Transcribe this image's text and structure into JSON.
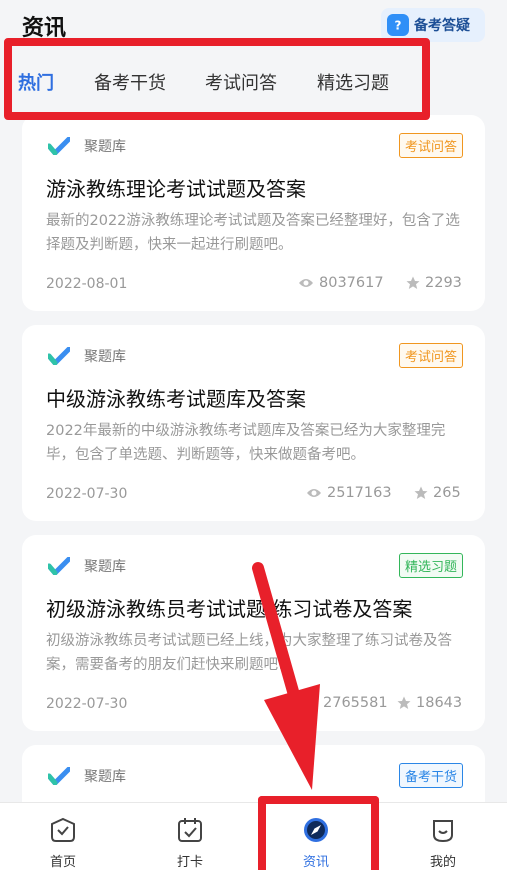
{
  "header": {
    "title": "资讯",
    "qa_label": "备考答疑"
  },
  "tabs": [
    {
      "label": "热门",
      "active": true
    },
    {
      "label": "备考干货",
      "active": false
    },
    {
      "label": "考试问答",
      "active": false
    },
    {
      "label": "精选习题",
      "active": false
    }
  ],
  "articles": [
    {
      "source": "聚题库",
      "tag": "考试问答",
      "tag_color": "#f0961f",
      "title": "游泳教练理论考试试题及答案",
      "desc": "最新的2022游泳教练理论考试试题及答案已经整理好，包含了选择题及判断题，快来一起进行刷题吧。",
      "date": "2022-08-01",
      "views": "8037617",
      "stars": "2293"
    },
    {
      "source": "聚题库",
      "tag": "考试问答",
      "tag_color": "#f0961f",
      "title": "中级游泳教练考试题库及答案",
      "desc": "2022年最新的中级游泳教练考试题库及答案已经为大家整理完毕，包含了单选题、判断题等，快来做题备考吧。",
      "date": "2022-07-30",
      "views": "2517163",
      "stars": "265"
    },
    {
      "source": "聚题库",
      "tag": "精选习题",
      "tag_color": "#33b65a",
      "title": "初级游泳教练员考试试题 练习试卷及答案",
      "desc": "初级游泳教练员考试试题已经上线，为大家整理了练习试卷及答案，需要备考的朋友们赶快来刷题吧!",
      "date": "2022-07-30",
      "views": "2765581",
      "stars": "18643"
    },
    {
      "source": "聚题库",
      "tag": "备考干货",
      "tag_color": "#2a86e6"
    }
  ],
  "bottom_nav": [
    {
      "label": "首页",
      "icon": "home-icon",
      "active": false
    },
    {
      "label": "打卡",
      "icon": "calendar-check-icon",
      "active": false
    },
    {
      "label": "资讯",
      "icon": "compass-icon",
      "active": true
    },
    {
      "label": "我的",
      "icon": "profile-icon",
      "active": false
    }
  ],
  "colors": {
    "accent": "#2f6fe0",
    "annotation": "#e8202a"
  }
}
